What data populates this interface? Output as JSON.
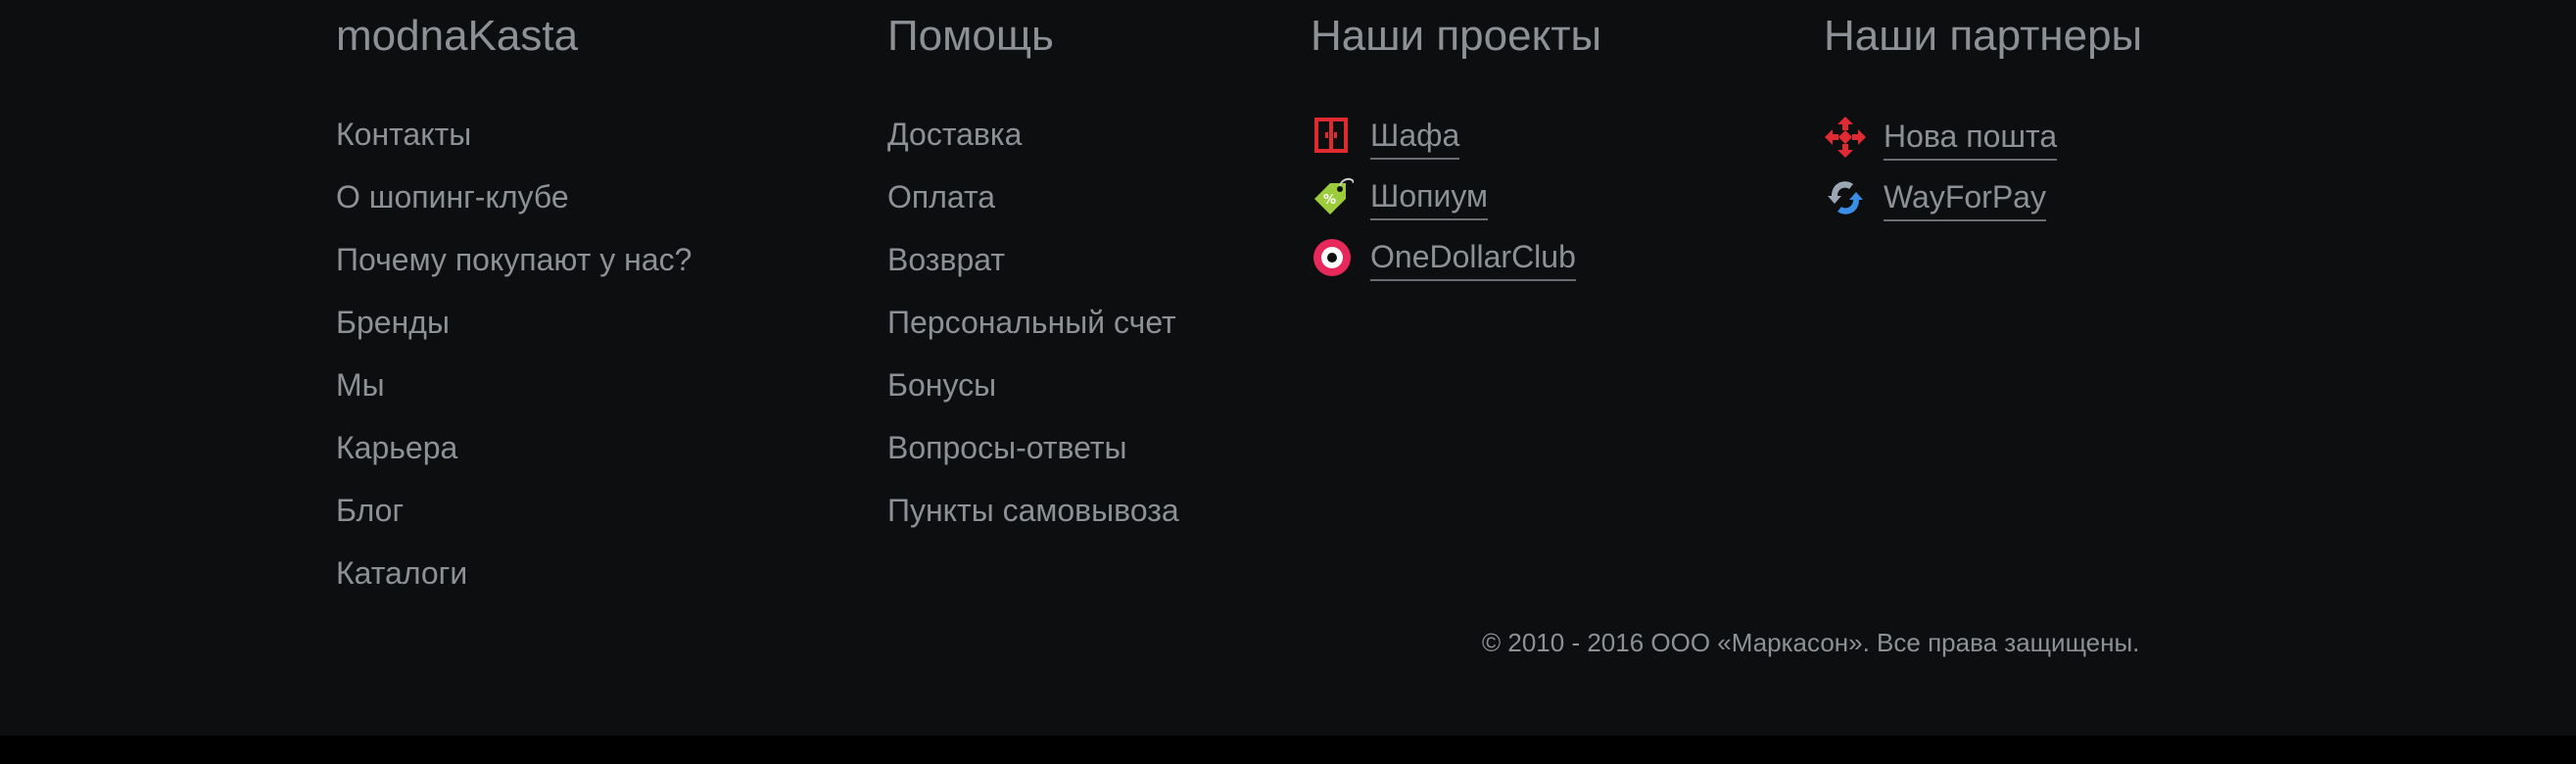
{
  "footer": {
    "col1": {
      "title": "modnaKasta",
      "links": [
        "Контакты",
        "О шопинг-клубе",
        "Почему покупают у нас?",
        "Бренды",
        "Мы",
        "Карьера",
        "Блог",
        "Каталоги"
      ]
    },
    "col2": {
      "title": "Помощь",
      "links": [
        "Доставка",
        "Оплата",
        "Возврат",
        "Персональный счет",
        "Бонусы",
        "Вопросы-ответы",
        "Пункты самовывоза"
      ]
    },
    "projects": {
      "title": "Наши проекты",
      "items": [
        {
          "label": "Шафа",
          "icon": "shafa-icon",
          "color": "#e02a32"
        },
        {
          "label": "Шопиум",
          "icon": "shopium-tag-icon",
          "color": "#9ccc3c"
        },
        {
          "label": "OneDollarClub",
          "icon": "onedollarclub-icon",
          "color": "#e8285a"
        }
      ]
    },
    "partners": {
      "title": "Наши партнеры",
      "items": [
        {
          "label": "Нова пошта",
          "icon": "nova-poshta-icon",
          "color": "#e02a32"
        },
        {
          "label": "WayForPay",
          "icon": "wayforpay-icon",
          "color": "#3a8ee6"
        }
      ]
    },
    "copyright": "© 2010 - 2016 ООО «Маркасон». Все права защищены."
  },
  "colors": {
    "background": "#0d0e10",
    "bottom_bar": "#000000",
    "text": "#8d9195"
  }
}
